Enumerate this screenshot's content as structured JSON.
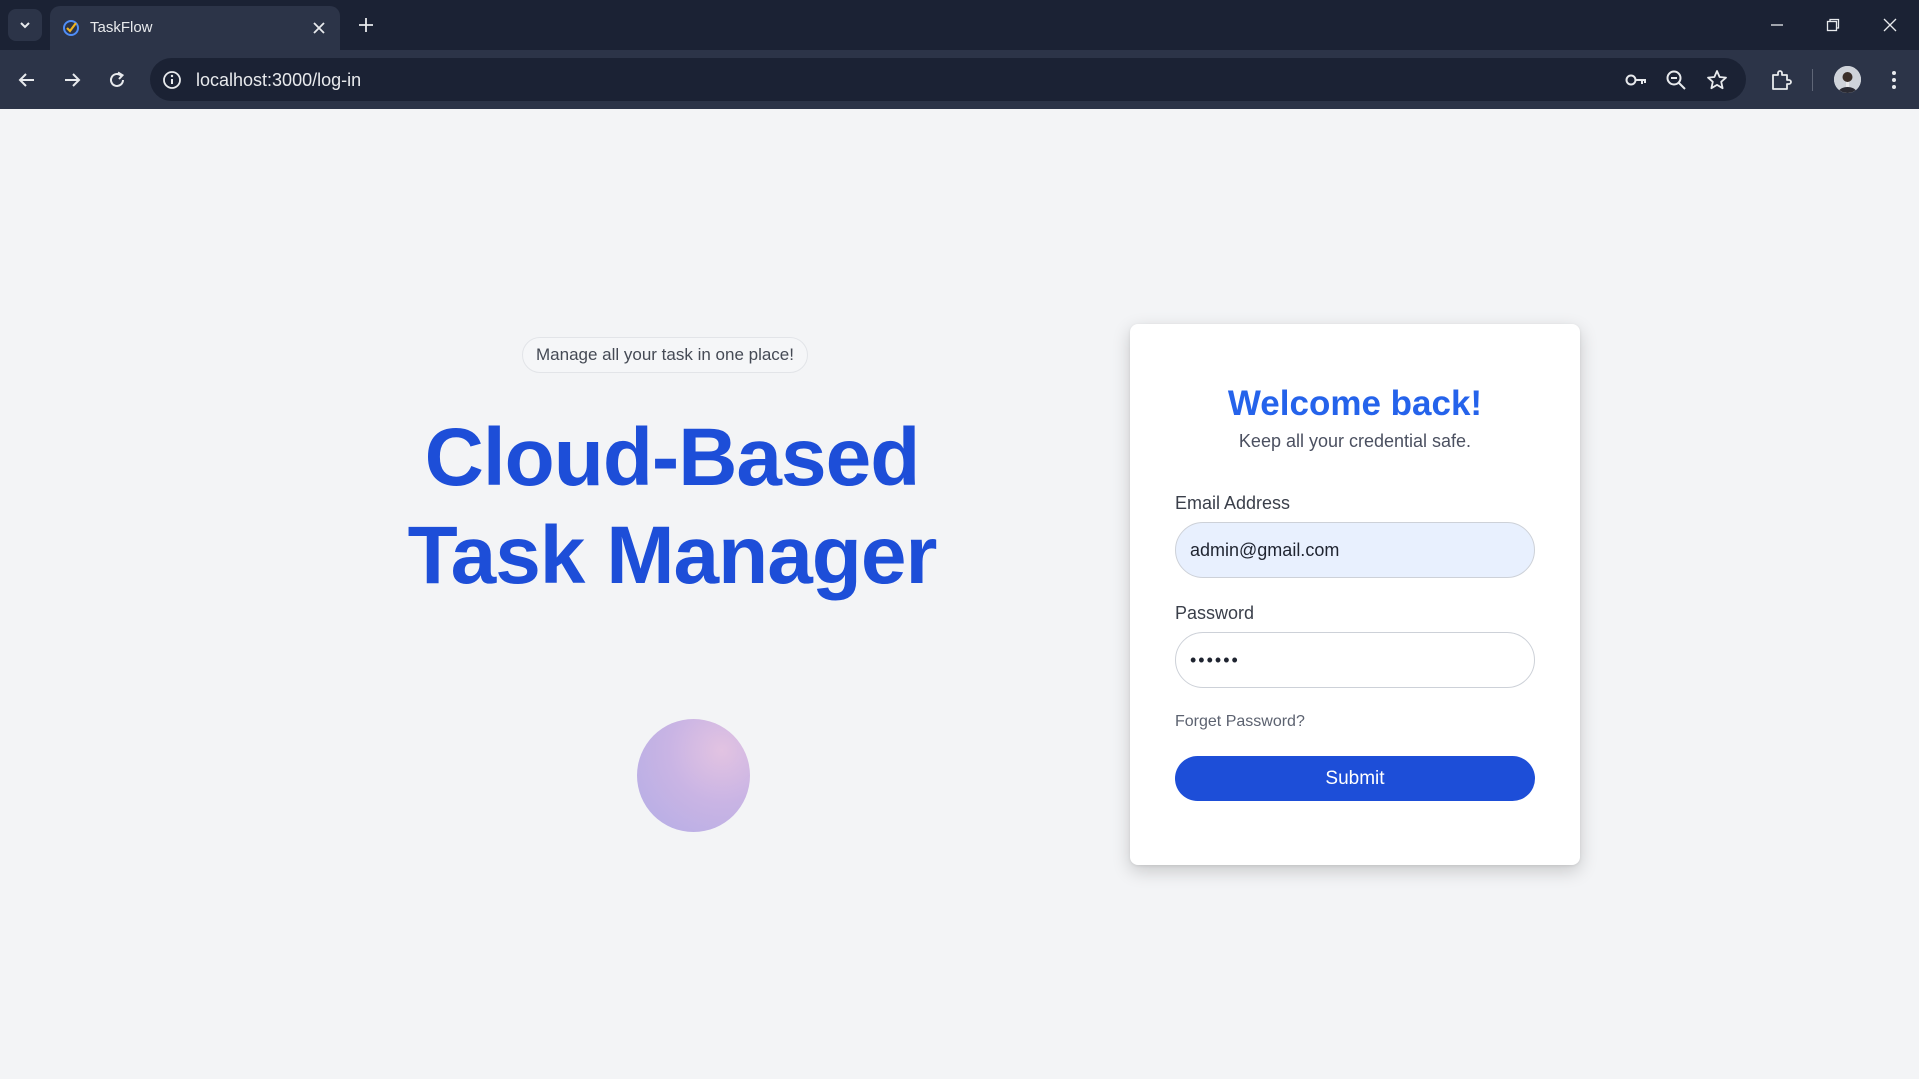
{
  "browser": {
    "tab_title": "TaskFlow",
    "url": "localhost:3000/log-in"
  },
  "hero": {
    "tagline": "Manage all your task in one place!",
    "title_line1": "Cloud-Based",
    "title_line2": "Task Manager"
  },
  "login": {
    "title": "Welcome back!",
    "subtitle": "Keep all your credential safe.",
    "email_label": "Email Address",
    "email_value": "admin@gmail.com",
    "password_label": "Password",
    "password_value": "••••••",
    "forget_link": "Forget Password?",
    "submit_label": "Submit"
  },
  "icons": {
    "tab_menu": "chevron-down-icon",
    "favicon": "taskflow-favicon",
    "tab_close": "close-icon",
    "new_tab": "plus-icon",
    "back": "arrow-left-icon",
    "forward": "arrow-right-icon",
    "reload": "reload-icon",
    "site_info": "info-icon",
    "password_key": "key-icon",
    "zoom": "zoom-icon",
    "bookmark": "star-icon",
    "extensions": "puzzle-icon",
    "profile": "avatar",
    "more": "kebab-menu-icon"
  },
  "colors": {
    "brand_blue": "#1d4ed8",
    "title_blue": "#2563eb",
    "page_bg": "#f3f4f6",
    "chrome_dark": "#1b2234"
  }
}
